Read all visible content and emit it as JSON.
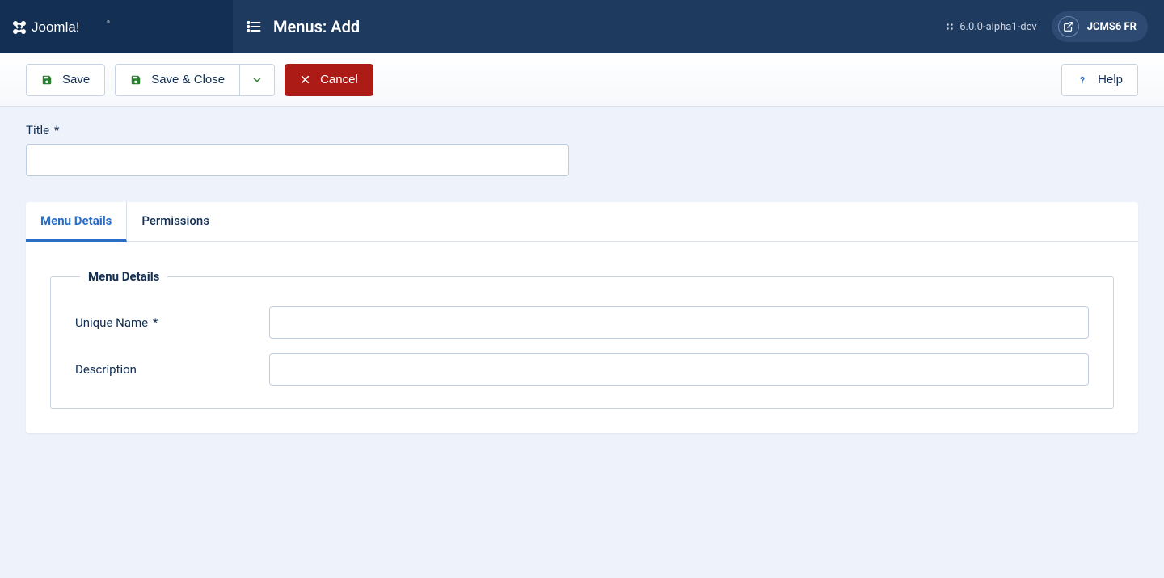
{
  "brand": {
    "name": "Joomla!"
  },
  "header": {
    "page_title": "Menus: Add",
    "version": "6.0.0-alpha1-dev",
    "site_name": "JCMS6 FR"
  },
  "toolbar": {
    "save": "Save",
    "save_close": "Save & Close",
    "cancel": "Cancel",
    "help": "Help"
  },
  "form": {
    "title_label": "Title",
    "title_value": "",
    "required": "*"
  },
  "tabs": {
    "details": "Menu Details",
    "permissions": "Permissions"
  },
  "section": {
    "legend": "Menu Details",
    "unique_name_label": "Unique Name",
    "unique_name_value": "",
    "description_label": "Description",
    "description_value": ""
  }
}
